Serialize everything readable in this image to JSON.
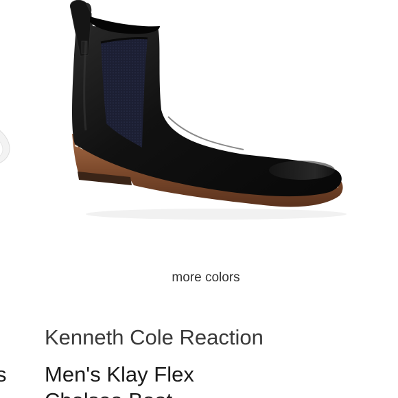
{
  "product": {
    "image_alt": "black leather chelsea boot",
    "more_colors_label": "more colors",
    "brand": "Kenneth Cole Reaction",
    "title_line1": "Men's Klay Flex",
    "title_line2": "Chelsea Boot"
  },
  "prev_card": {
    "title_fragment": "s"
  },
  "colors": {
    "boot_leather": "#141414",
    "elastic_panel": "#1d2033",
    "sole_welt": "#8a5434",
    "stitching": "#e8dccb"
  }
}
